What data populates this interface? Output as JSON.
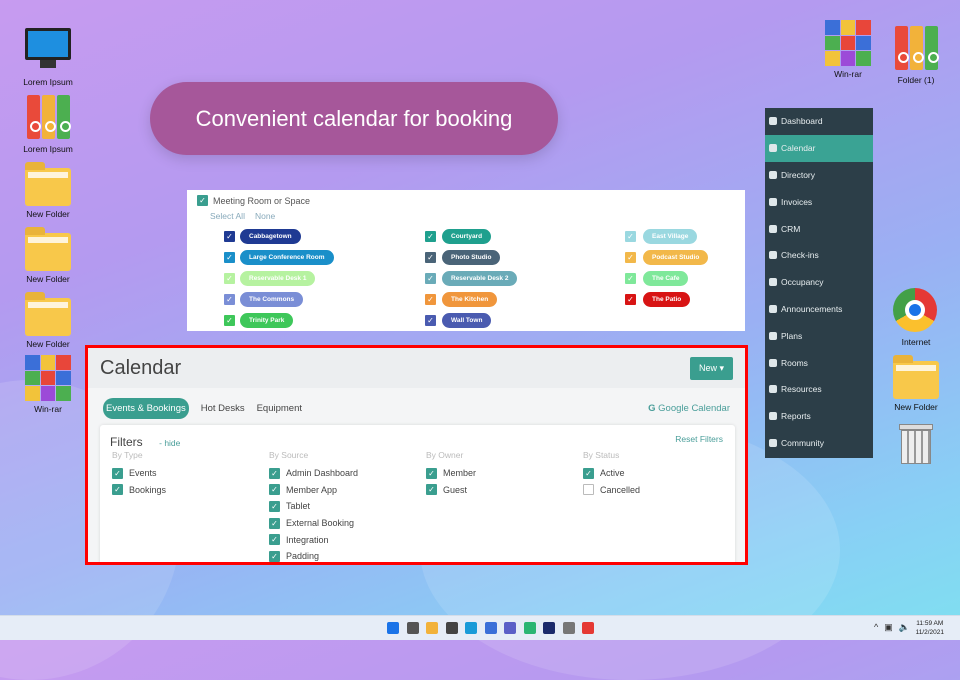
{
  "desktop": {
    "left_icons": [
      {
        "label": "Lorem Ipsum",
        "icon": "computer-icon"
      },
      {
        "label": "Lorem Ipsum",
        "icon": "binders-icon"
      },
      {
        "label": "New Folder",
        "icon": "folder-icon"
      },
      {
        "label": "New Folder",
        "icon": "folder-icon"
      },
      {
        "label": "New Folder",
        "icon": "folder-icon"
      },
      {
        "label": "Win-rar",
        "icon": "winrar-icon"
      }
    ],
    "right_icons": [
      {
        "label": "Win-rar",
        "icon": "winrar-icon"
      },
      {
        "label": "Folder (1)",
        "icon": "binders-icon"
      },
      {
        "label": "Internet",
        "icon": "chrome-icon"
      },
      {
        "label": "New Folder",
        "icon": "folder-icon"
      },
      {
        "label": "",
        "icon": "recycle-bin-icon"
      }
    ]
  },
  "banner": {
    "title": "Convenient calendar for booking"
  },
  "sidebar": {
    "items": [
      {
        "label": "Dashboard"
      },
      {
        "label": "Calendar",
        "active": true
      },
      {
        "label": "Directory"
      },
      {
        "label": "Invoices"
      },
      {
        "label": "CRM"
      },
      {
        "label": "Check-ins"
      },
      {
        "label": "Occupancy"
      },
      {
        "label": "Announcements"
      },
      {
        "label": "Plans"
      },
      {
        "label": "Rooms"
      },
      {
        "label": "Resources"
      },
      {
        "label": "Reports"
      },
      {
        "label": "Community"
      }
    ]
  },
  "rooms": {
    "group_label": "Meeting Room or Space",
    "select_all": "Select All",
    "none": "None",
    "columns": [
      [
        {
          "label": "Cabbagetown",
          "color": "#1f3a93"
        },
        {
          "label": "Large Conference Room",
          "color": "#1a8fc9"
        },
        {
          "label": "Reservable Desk 1",
          "color": "#b6f2a0"
        },
        {
          "label": "The Commons",
          "color": "#7a8ed6"
        },
        {
          "label": "Trinity Park",
          "color": "#3ec75a"
        }
      ],
      [
        {
          "label": "Courtyard",
          "color": "#1fa08e"
        },
        {
          "label": "Photo Studio",
          "color": "#4a6478"
        },
        {
          "label": "Reservable Desk 2",
          "color": "#6aabb8"
        },
        {
          "label": "The Kitchen",
          "color": "#f0963c"
        },
        {
          "label": "Wall Town",
          "color": "#4a5bb0"
        }
      ],
      [
        {
          "label": "East Village",
          "color": "#9ad8e0"
        },
        {
          "label": "Podcast Studio",
          "color": "#f2b84a"
        },
        {
          "label": "The Cafe",
          "color": "#7fe89a"
        },
        {
          "label": "The Patio",
          "color": "#d81414"
        }
      ]
    ]
  },
  "calendar": {
    "title": "Calendar",
    "new_button": "New ▾",
    "tabs": [
      "Events & Bookings",
      "Hot Desks",
      "Equipment"
    ],
    "google_calendar": "Google Calendar",
    "filters": {
      "title": "Filters",
      "hide": "- hide",
      "reset": "Reset Filters",
      "groups": [
        {
          "heading": "By Type",
          "items": [
            {
              "label": "Events",
              "checked": true
            },
            {
              "label": "Bookings",
              "checked": true
            }
          ]
        },
        {
          "heading": "By Source",
          "items": [
            {
              "label": "Admin Dashboard",
              "checked": true
            },
            {
              "label": "Member App",
              "checked": true
            },
            {
              "label": "Tablet",
              "checked": true
            },
            {
              "label": "External Booking",
              "checked": true
            },
            {
              "label": "Integration",
              "checked": true
            },
            {
              "label": "Padding",
              "checked": true
            }
          ]
        },
        {
          "heading": "By Owner",
          "items": [
            {
              "label": "Member",
              "checked": true
            },
            {
              "label": "Guest",
              "checked": true
            }
          ]
        },
        {
          "heading": "By Status",
          "items": [
            {
              "label": "Active",
              "checked": true
            },
            {
              "label": "Cancelled",
              "checked": false
            }
          ]
        }
      ]
    }
  },
  "taskbar": {
    "time": "11:59 AM",
    "date": "11/2/2021",
    "tray": "^"
  }
}
